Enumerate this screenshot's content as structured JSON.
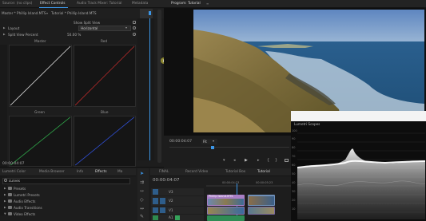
{
  "effect_controls": {
    "tabs": [
      {
        "label": "Source: (no clips)"
      },
      {
        "label": "Effect Controls"
      },
      {
        "label": "Audio Track Mixer: Tutorial"
      },
      {
        "label": "Metadata"
      }
    ],
    "clip_master": "Master * Phillip Island.MTS",
    "clip_sequence": "Tutorial * Phillip Island.MTS",
    "show_split_view": "Show Split View",
    "layout_label": "Layout",
    "layout_value": "Horizontal",
    "split_view_label": "Split View Percent",
    "split_view_value": "50.00 %",
    "curves": {
      "master": {
        "label": "Master",
        "color": "#e6e6e6"
      },
      "red": {
        "label": "Red",
        "color": "#c02a2a"
      },
      "green": {
        "label": "Green",
        "color": "#2fa84a"
      },
      "blue": {
        "label": "Blue",
        "color": "#3050d8"
      }
    },
    "timecode": "00:00:04:07"
  },
  "program_monitor": {
    "tab": "Program: Tutorial",
    "timecode": "00:00:04:07",
    "fit": "Fit"
  },
  "lumetri_scopes": {
    "title": "Lumetri Scopes",
    "ticks": [
      "100",
      "90",
      "80",
      "70",
      "60",
      "50",
      "40",
      "30",
      "20",
      "10"
    ]
  },
  "effects_panel": {
    "tabs": [
      {
        "label": "Lumetri Color"
      },
      {
        "label": "Media Browser"
      },
      {
        "label": "Info"
      },
      {
        "label": "Effects"
      },
      {
        "label": "Ma"
      }
    ],
    "search_value": "curves",
    "items": [
      {
        "label": "Presets"
      },
      {
        "label": "Lumetri Presets"
      },
      {
        "label": "Audio Effects"
      },
      {
        "label": "Audio Transitions"
      },
      {
        "label": "Video Effects"
      }
    ]
  },
  "timeline": {
    "tabs": [
      {
        "label": "FINAL"
      },
      {
        "label": "Record Video"
      },
      {
        "label": "Tutorial Box"
      },
      {
        "label": "Tutorial"
      }
    ],
    "timecode": "00:00:04:07",
    "tracks": [
      {
        "label": "V3"
      },
      {
        "label": "V2"
      },
      {
        "label": "V1"
      },
      {
        "label": "A1"
      }
    ],
    "ruler": [
      "00:00:04:23",
      "00:00:05:23"
    ],
    "clip_label": "Phillip Island.MTS"
  },
  "colors": {
    "accent": "#3c96e6",
    "panel": "#1d1d1d",
    "header": "#232323"
  }
}
